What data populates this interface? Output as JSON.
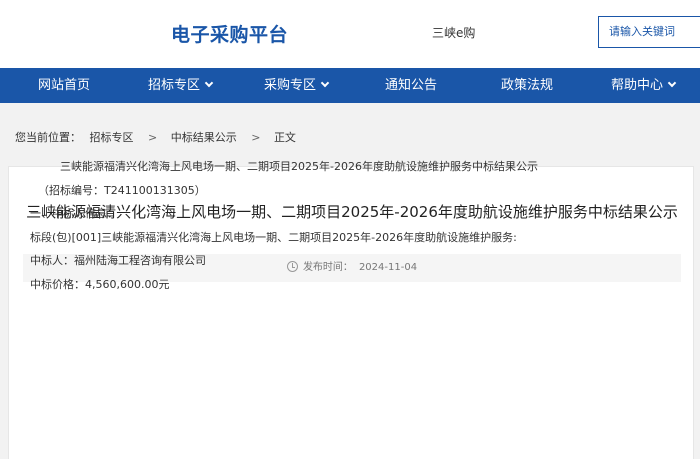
{
  "header": {
    "logo": "电子采购平台",
    "brand_link": "三峡e购",
    "search_placeholder": "请输入关键词"
  },
  "nav": {
    "items": [
      {
        "label": "网站首页",
        "has_dropdown": false
      },
      {
        "label": "招标专区",
        "has_dropdown": true
      },
      {
        "label": "采购专区",
        "has_dropdown": true
      },
      {
        "label": "通知公告",
        "has_dropdown": false
      },
      {
        "label": "政策法规",
        "has_dropdown": false
      },
      {
        "label": "帮助中心",
        "has_dropdown": true
      }
    ]
  },
  "breadcrumb": {
    "prefix": "您当前位置：",
    "items": [
      "招标专区",
      "中标结果公示",
      "正文"
    ],
    "separator": ">"
  },
  "article": {
    "title": "三峡能源福清兴化湾海上风电场一期、二期项目2025年-2026年度助航设施维护服务中标结果公示",
    "published_label": "发布时间：",
    "published_date": "2024-11-04",
    "lines": [
      "三峡能源福清兴化湾海上风电场一期、二期项目2025年-2026年度助航设施维护服务中标结果公示",
      "（招标编号：T241100131305）",
      "一、中标人信息：",
      "标段(包)[001]三峡能源福清兴化湾海上风电场一期、二期项目2025年-2026年度助航设施维护服务:",
      "中标人：福州陆海工程咨询有限公司",
      "中标价格：4,560,600.00元"
    ]
  },
  "colors": {
    "brand_blue": "#1a56a8",
    "background": "#f2f2f2"
  }
}
